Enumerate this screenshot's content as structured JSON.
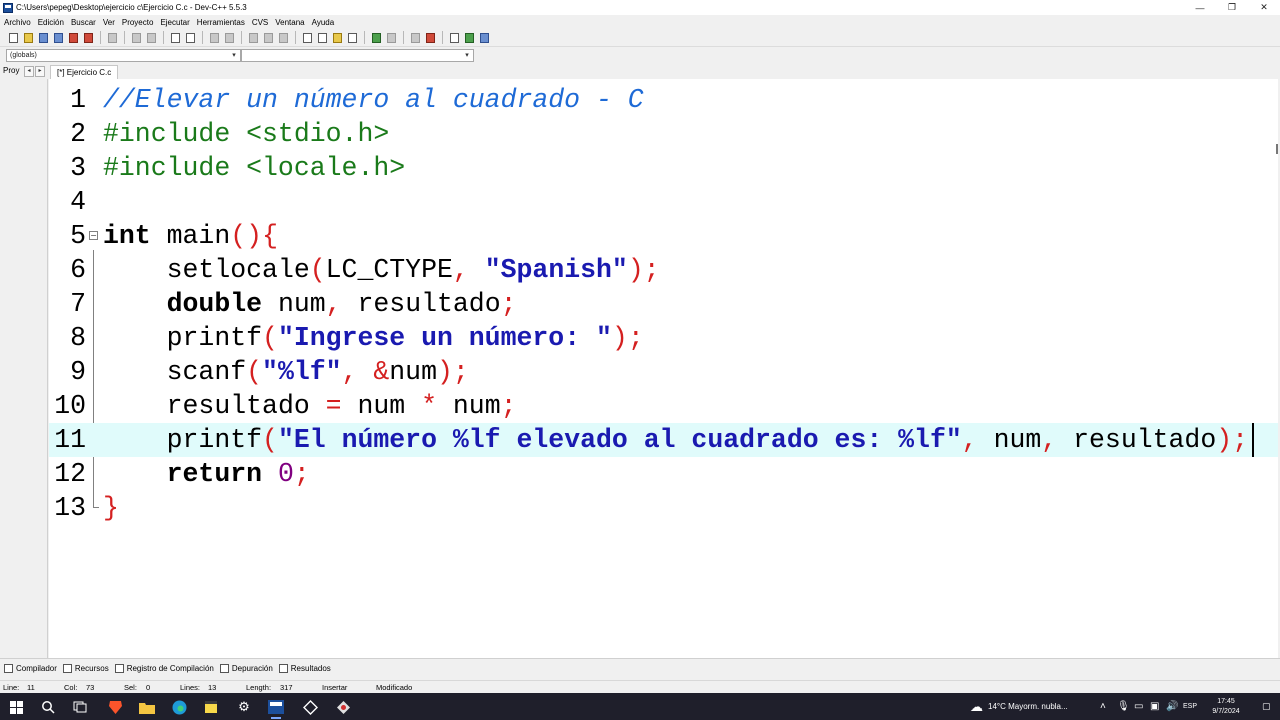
{
  "window": {
    "title": "C:\\Users\\pepeg\\Desktop\\ejercicio  c\\Ejercicio C.c - Dev-C++ 5.5.3",
    "controls": [
      "minimize-icon",
      "restore-icon",
      "close-icon"
    ]
  },
  "menu": {
    "items": [
      "Archivo",
      "Edición",
      "Buscar",
      "Ver",
      "Proyecto",
      "Ejecutar",
      "Herramientas",
      "CVS",
      "Ventana",
      "Ayuda"
    ]
  },
  "combos": {
    "scope": "(globals)",
    "member": ""
  },
  "tabs": {
    "project": "Proy",
    "editor": "[*] Ejercicio C.c"
  },
  "editor": {
    "current_line": 11,
    "lines": [
      {
        "n": "1",
        "code": "//Elevar un número al cuadrado - C"
      },
      {
        "n": "2",
        "code": "#include <stdio.h>"
      },
      {
        "n": "3",
        "code": "#include <locale.h>"
      },
      {
        "n": "4",
        "code": ""
      },
      {
        "n": "5",
        "code": "int main(){"
      },
      {
        "n": "6",
        "code": "    setlocale(LC_CTYPE, \"Spanish\");"
      },
      {
        "n": "7",
        "code": "    double num, resultado;"
      },
      {
        "n": "8",
        "code": "    printf(\"Ingrese un número: \");"
      },
      {
        "n": "9",
        "code": "    scanf(\"%lf\", &num);"
      },
      {
        "n": "10",
        "code": "    resultado = num * num;"
      },
      {
        "n": "11",
        "code": "    printf(\"El número %lf elevado al cuadrado es: %lf\", num, resultado);"
      },
      {
        "n": "12",
        "code": "    return 0;"
      },
      {
        "n": "13",
        "code": "}"
      }
    ],
    "colors": {
      "comment": "#1e6ad6",
      "preprocessor": "#1a7a1a",
      "punctuation": "#d42020",
      "string": "#1a1ab0",
      "number": "#800080",
      "current_line_bg": "#e0fbfb"
    }
  },
  "bottom_tabs": [
    "Compilador",
    "Recursos",
    "Registro de Compilación",
    "Depuración",
    "Resultados"
  ],
  "status": {
    "line_label": "Line:",
    "line_value": "11",
    "col_label": "Col:",
    "col_value": "73",
    "sel_label": "Sel:",
    "sel_value": "0",
    "lines_label": "Lines:",
    "lines_value": "13",
    "length_label": "Length:",
    "length_value": "317",
    "mode": "Insertar",
    "state": "Modificado"
  },
  "taskbar": {
    "weather": "14°C  Mayorm. nubla...",
    "language": "ESP",
    "time": "17:45",
    "date": "9/7/2024"
  }
}
